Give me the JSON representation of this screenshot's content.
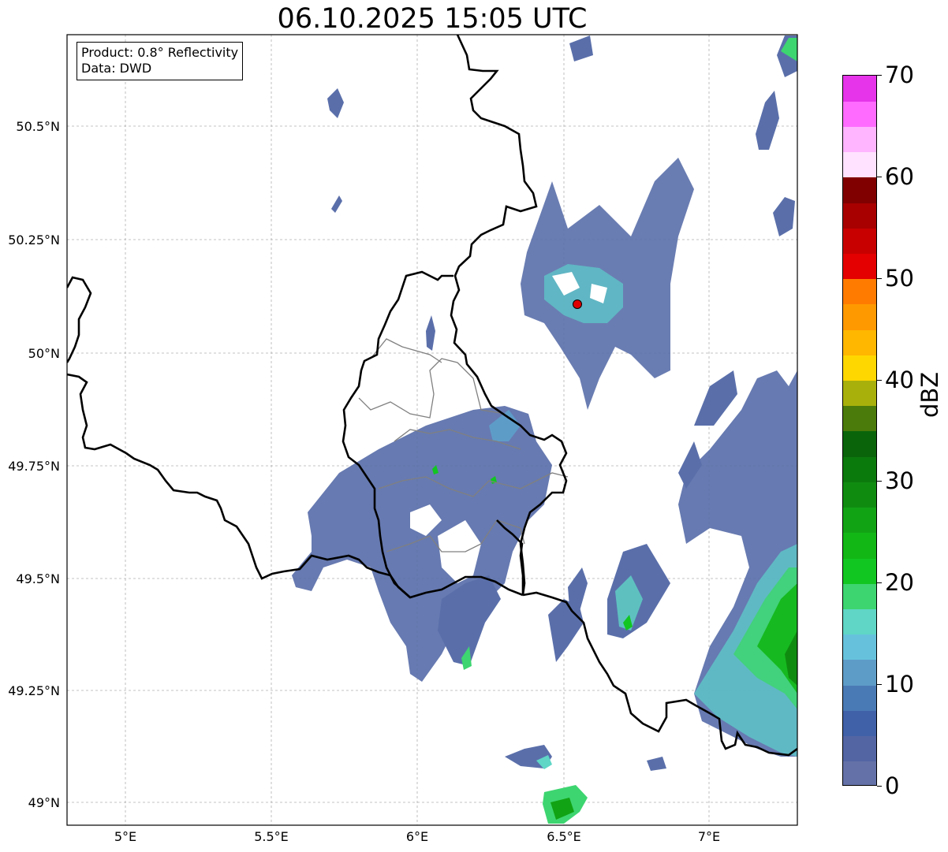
{
  "title": "06.10.2025 15:05 UTC",
  "info_box": {
    "product": "Product: 0.8° Reflectivity",
    "data": "Data: DWD"
  },
  "lat_labels": [
    "50.5°N",
    "50.25°N",
    "50°N",
    "49.75°N",
    "49.5°N",
    "49.25°N",
    "49°N"
  ],
  "lon_labels": [
    "5°E",
    "5.5°E",
    "6°E",
    "6.5°E",
    "7°E"
  ],
  "colorbar": {
    "label": "dBZ",
    "ticks": [
      "0",
      "10",
      "20",
      "30",
      "40",
      "50",
      "60",
      "70"
    ],
    "colors": [
      "#6471a8",
      "#5365a3",
      "#4060a8",
      "#4a7ab5",
      "#5e9cc8",
      "#66c2dc",
      "#5fd6c6",
      "#3dd570",
      "#12c621",
      "#12b716",
      "#12a314",
      "#0f8c10",
      "#0b7a0c",
      "#0a650a",
      "#4b7b0a",
      "#a8b00b",
      "#ffd700",
      "#ffb700",
      "#ff9900",
      "#ff7b00",
      "#e40000",
      "#c80000",
      "#a80000",
      "#800000",
      "#ffe2ff",
      "#ffb5ff",
      "#ff6bff",
      "#e534e9"
    ]
  },
  "radar_site": {
    "name": "radar site",
    "color": "#e00000"
  },
  "map": {
    "lon_range": [
      4.8,
      7.3
    ],
    "lat_range": [
      48.95,
      50.7
    ]
  }
}
